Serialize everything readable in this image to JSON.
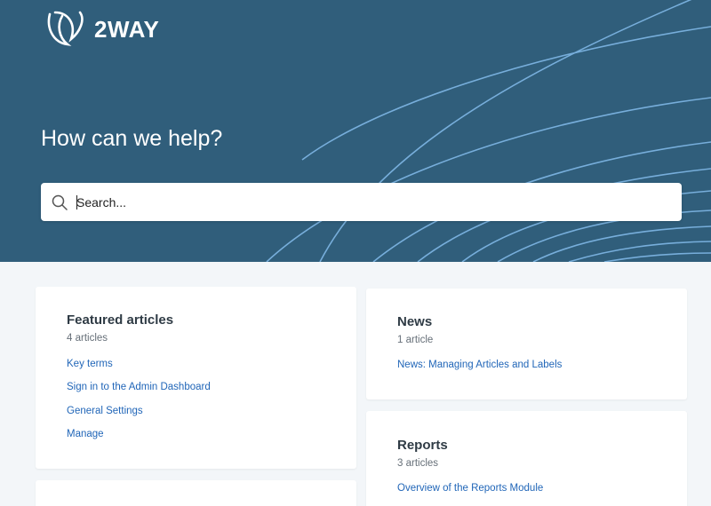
{
  "brand": {
    "name": "2WAY",
    "logo_icon": "swoosh-leaf-icon"
  },
  "hero": {
    "title": "How can we help?",
    "background_color": "#305e7b",
    "line_color": "#7fb7e6"
  },
  "search": {
    "placeholder": "Search...",
    "icon": "search-icon"
  },
  "colors": {
    "page_bg": "#f3f6f9",
    "link": "#2166b8",
    "heading": "#2f3b45",
    "muted": "#666f78"
  },
  "cards": {
    "featured": {
      "title": "Featured articles",
      "count": "4 articles",
      "links": [
        "Key terms",
        "Sign in to the Admin Dashboard",
        "General Settings",
        "Manage"
      ]
    },
    "news": {
      "title": "News",
      "count": "1 article",
      "links": [
        "News: Managing Articles and Labels"
      ]
    },
    "reports": {
      "title": "Reports",
      "count": "3 articles",
      "links": [
        "Overview of the Reports Module"
      ]
    }
  }
}
